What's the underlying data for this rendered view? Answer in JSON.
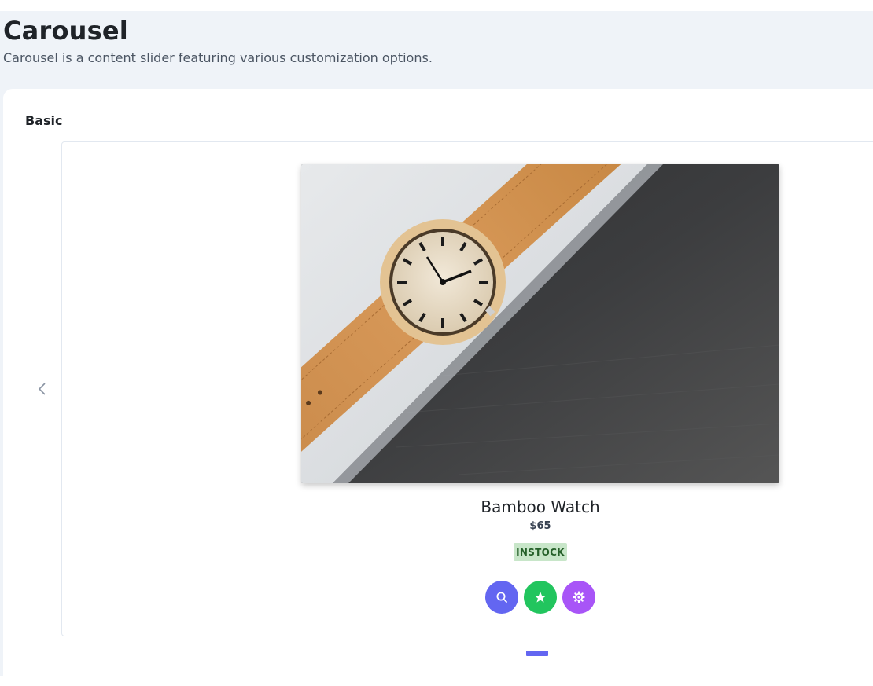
{
  "page": {
    "title": "Carousel",
    "description": "Carousel is a content slider featuring various customization options."
  },
  "section": {
    "title": "Basic"
  },
  "carousel": {
    "prev_icon": "chevron-left-icon",
    "active_indicator": 0,
    "indicator_color": "#6366f1",
    "product": {
      "name": "Bamboo Watch",
      "price": "$65",
      "inventory_status": "INSTOCK",
      "image": "bamboo-watch-photo"
    },
    "actions": [
      {
        "icon": "search-icon",
        "color": "#6366f1"
      },
      {
        "icon": "star-icon",
        "color": "#22c55e"
      },
      {
        "icon": "cog-icon",
        "color": "#a855f7"
      }
    ]
  },
  "colors": {
    "page_background": "#eff3f8",
    "badge_background": "#c8e6c9",
    "badge_text": "#256029"
  }
}
